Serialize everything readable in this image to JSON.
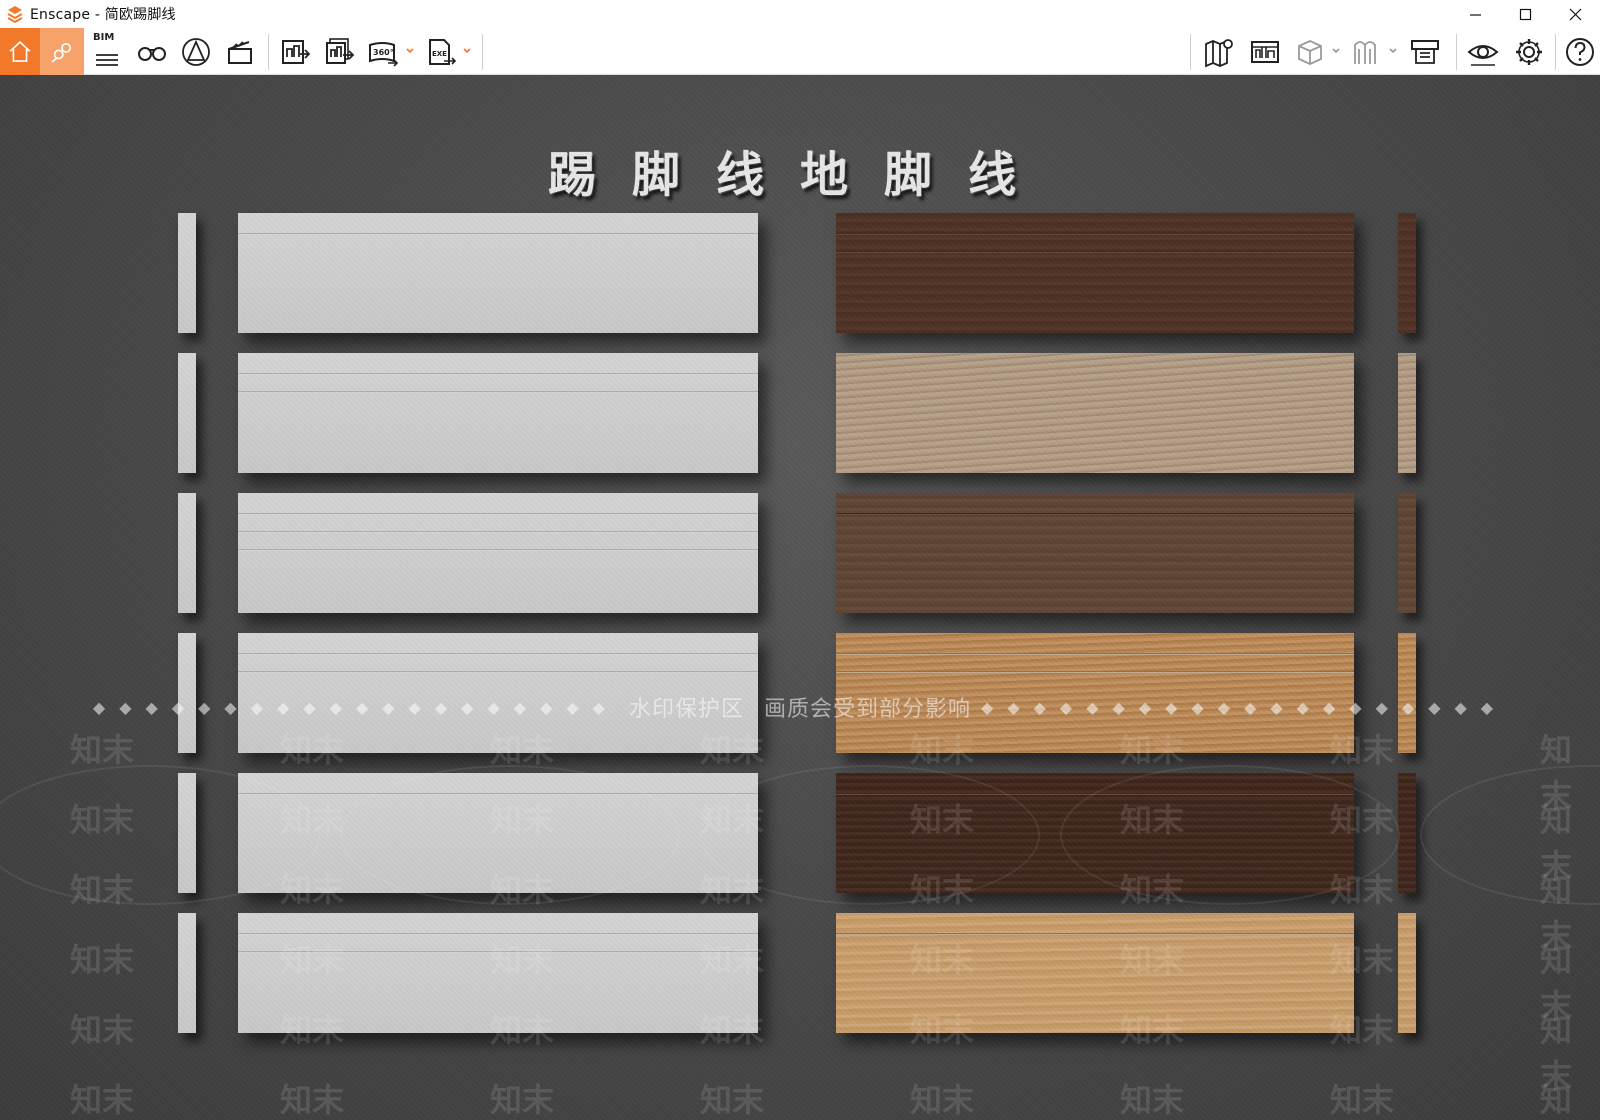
{
  "window": {
    "title": "Enscape - 简欧踢脚线",
    "controls": [
      "minimize",
      "maximize",
      "close"
    ]
  },
  "toolbar": {
    "bim_label": "BIM",
    "left_tools": [
      {
        "name": "home-icon",
        "active": true
      },
      {
        "name": "location-pins-icon",
        "active": true
      },
      {
        "name": "bim-info-icon"
      },
      {
        "name": "binoculars-icon"
      },
      {
        "name": "perspective-icon"
      },
      {
        "name": "clapperboard-icon"
      },
      {
        "name": "export-image-icon"
      },
      {
        "name": "batch-render-icon"
      },
      {
        "name": "panorama-360-icon"
      },
      {
        "name": "exe-export-icon"
      }
    ],
    "right_tools": [
      {
        "name": "map-icon"
      },
      {
        "name": "asset-library-icon"
      },
      {
        "name": "cube-view-icon"
      },
      {
        "name": "material-icon"
      },
      {
        "name": "collaboration-icon"
      },
      {
        "name": "visibility-icon"
      },
      {
        "name": "settings-icon"
      },
      {
        "name": "help-icon"
      }
    ],
    "accent_color": "#f2782a"
  },
  "scene": {
    "title": "踢脚线地脚线",
    "watermark_text_1": "水印保护区",
    "watermark_text_2": "画质会受到部分影响",
    "watermark_tile": "知末",
    "left_boards": [
      {
        "finish": "white",
        "grooves": 1
      },
      {
        "finish": "white",
        "grooves": 2
      },
      {
        "finish": "white",
        "grooves": 3
      },
      {
        "finish": "white",
        "grooves": 2
      },
      {
        "finish": "white",
        "grooves": 1
      },
      {
        "finish": "white",
        "grooves": 2
      }
    ],
    "right_boards": [
      {
        "finish": "wood-dark",
        "grooves": 2
      },
      {
        "finish": "wood-light",
        "grooves": 0
      },
      {
        "finish": "wood-mid",
        "grooves": 1
      },
      {
        "finish": "wood-oak",
        "grooves": 2
      },
      {
        "finish": "wood-walnut",
        "grooves": 1
      },
      {
        "finish": "wood-maple",
        "grooves": 1
      }
    ]
  }
}
